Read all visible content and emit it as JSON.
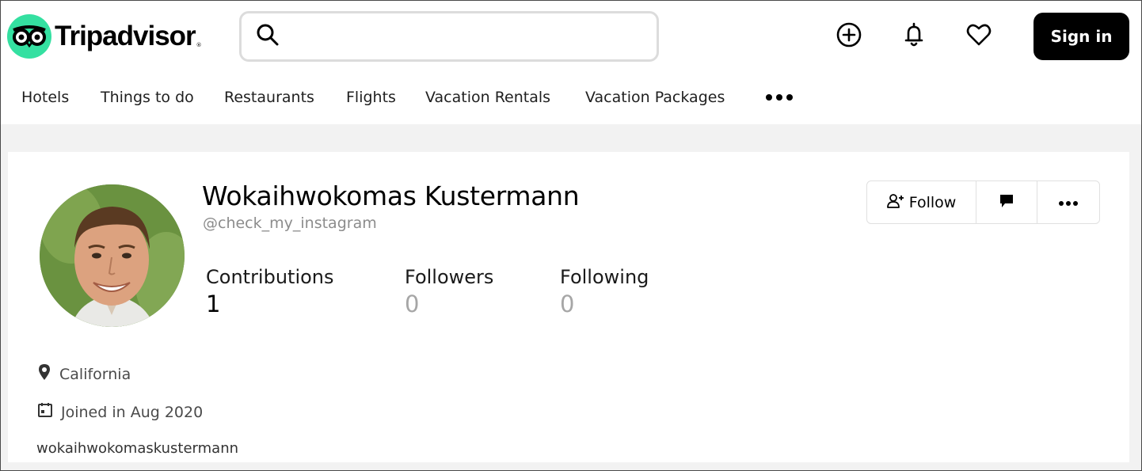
{
  "header": {
    "logo_text": "Tripadvisor",
    "search": {
      "value": "",
      "placeholder": ""
    },
    "icons": [
      "plus-circle-icon",
      "bell-icon",
      "heart-icon"
    ],
    "signin_label": "Sign in"
  },
  "nav": {
    "items": [
      "Hotels",
      "Things to do",
      "Restaurants",
      "Flights",
      "Vacation Rentals",
      "Vacation Packages"
    ],
    "more_icon": "more-horizontal-icon"
  },
  "profile": {
    "name": "Wokaihwokomas Kustermann",
    "handle": "@check_my_instagram",
    "stats": [
      {
        "label": "Contributions",
        "value": "1"
      },
      {
        "label": "Followers",
        "value": "0"
      },
      {
        "label": "Following",
        "value": "0"
      }
    ],
    "actions": {
      "follow_label": "Follow"
    },
    "location": "California",
    "joined": "Joined in Aug 2020",
    "bio": "wokaihwokomaskustermann"
  },
  "colors": {
    "brand_green": "#34e0a1",
    "signin_bg": "#000000",
    "page_bg": "#f2f2f2"
  }
}
